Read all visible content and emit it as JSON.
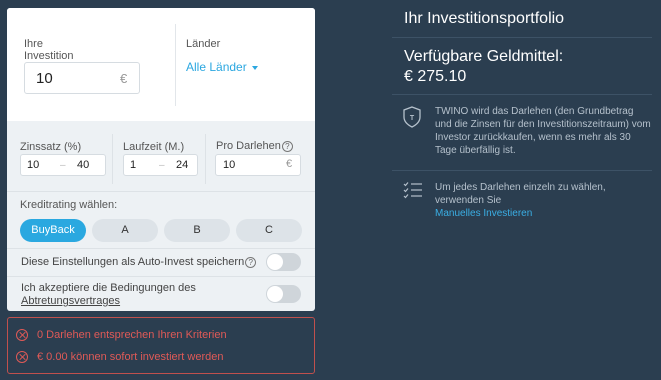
{
  "form": {
    "investment_label": "Ihre Investition",
    "investment_value": "10",
    "currency": "€",
    "countries_label": "Länder",
    "countries_value": "Alle Länder",
    "interest_label": "Zinssatz (%)",
    "interest_from": "10",
    "interest_to": "40",
    "term_label": "Laufzeit (M.)",
    "term_from": "1",
    "term_to": "24",
    "per_loan_label": "Pro Darlehen",
    "per_loan_value": "10",
    "dash": "–",
    "rating_label": "Kreditrating wählen:",
    "ratings": [
      "BuyBack",
      "A",
      "B",
      "C"
    ],
    "save_autoinvest_label": "Diese Einstellungen als Auto-Invest speichern",
    "accept_terms_line1": "Ich akzeptiere die Bedingungen des",
    "accept_terms_link": "Abtretungsvertrages",
    "help_glyph": "?"
  },
  "errors": [
    "0 Darlehen entsprechen Ihren Kriterien",
    "€ 0.00 können sofort investiert werden"
  ],
  "portfolio": {
    "title": "Ihr Investitionsportfolio",
    "funds_label": "Verfügbare Geldmittel:",
    "funds_value": "€ 275.10",
    "buyback_text": "TWINO wird das Darlehen (den Grundbetrag und die Zinsen für den Investitionszeitraum) vom Investor zurückkaufen, wenn es mehr als 30 Tage überfällig ist.",
    "manual_text": "Um jedes Darlehen einzeln zu wählen, verwenden Sie",
    "manual_link": "Manuelles Investieren"
  },
  "colors": {
    "accent": "#2aa8e0",
    "error": "#e05a57",
    "background": "#2b3e50"
  }
}
